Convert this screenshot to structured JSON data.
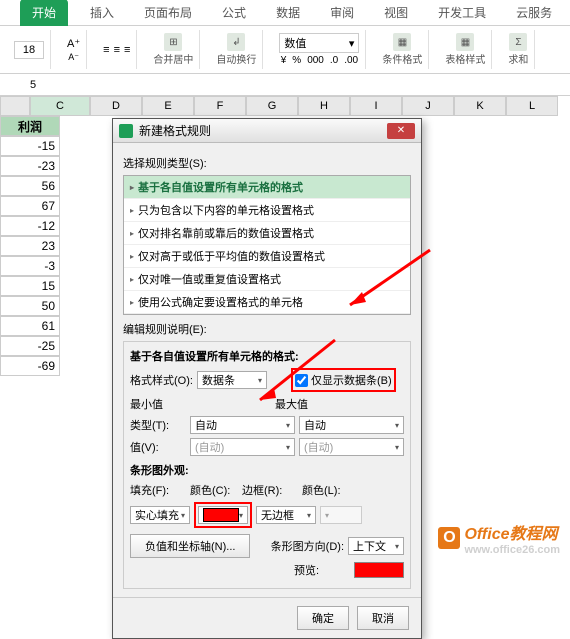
{
  "ribbon": {
    "tabs": [
      "开始",
      "插入",
      "页面布局",
      "公式",
      "数据",
      "审阅",
      "视图",
      "开发工具",
      "云服务"
    ],
    "active_tab": "开始",
    "font_size": "18",
    "merge_label": "合并居中",
    "wrap_label": "自动换行",
    "number_format": "数值",
    "cond_format": "条件格式",
    "table_style": "表格样式",
    "sum_label": "求和"
  },
  "formula_value": "5",
  "columns": [
    "C",
    "D",
    "E",
    "F",
    "G",
    "H",
    "I",
    "J",
    "K",
    "L"
  ],
  "data_col_header": "利润",
  "data_values": [
    "-15",
    "-23",
    "56",
    "67",
    "-12",
    "23",
    "-3",
    "15",
    "50",
    "61",
    "-25",
    "-69"
  ],
  "dialog": {
    "title": "新建格式规则",
    "section1_label": "选择规则类型(S):",
    "rules": [
      "基于各自值设置所有单元格的格式",
      "只为包含以下内容的单元格设置格式",
      "仅对排名靠前或靠后的数值设置格式",
      "仅对高于或低于平均值的数值设置格式",
      "仅对唯一值或重复值设置格式",
      "使用公式确定要设置格式的单元格"
    ],
    "section2_label": "编辑规则说明(E):",
    "desc_header": "基于各自值设置所有单元格的格式:",
    "format_style_label": "格式样式(O):",
    "format_style_value": "数据条",
    "show_bar_only_label": "仅显示数据条(B)",
    "min_label": "最小值",
    "max_label": "最大值",
    "type_label": "类型(T):",
    "type_min": "自动",
    "type_max": "自动",
    "value_label": "值(V):",
    "value_placeholder": "(自动)",
    "appearance_label": "条形图外观:",
    "fill_label": "填充(F):",
    "fill_value": "实心填充",
    "color_label": "颜色(C):",
    "border_label": "边框(R):",
    "border_value": "无边框",
    "border_color_label": "颜色(L):",
    "neg_axis_btn": "负值和坐标轴(N)...",
    "bar_dir_label": "条形图方向(D):",
    "bar_dir_value": "上下文",
    "preview_label": "预览:",
    "ok": "确定",
    "cancel": "取消"
  },
  "watermark": {
    "text": "Office教程网",
    "url": "www.office26.com"
  }
}
